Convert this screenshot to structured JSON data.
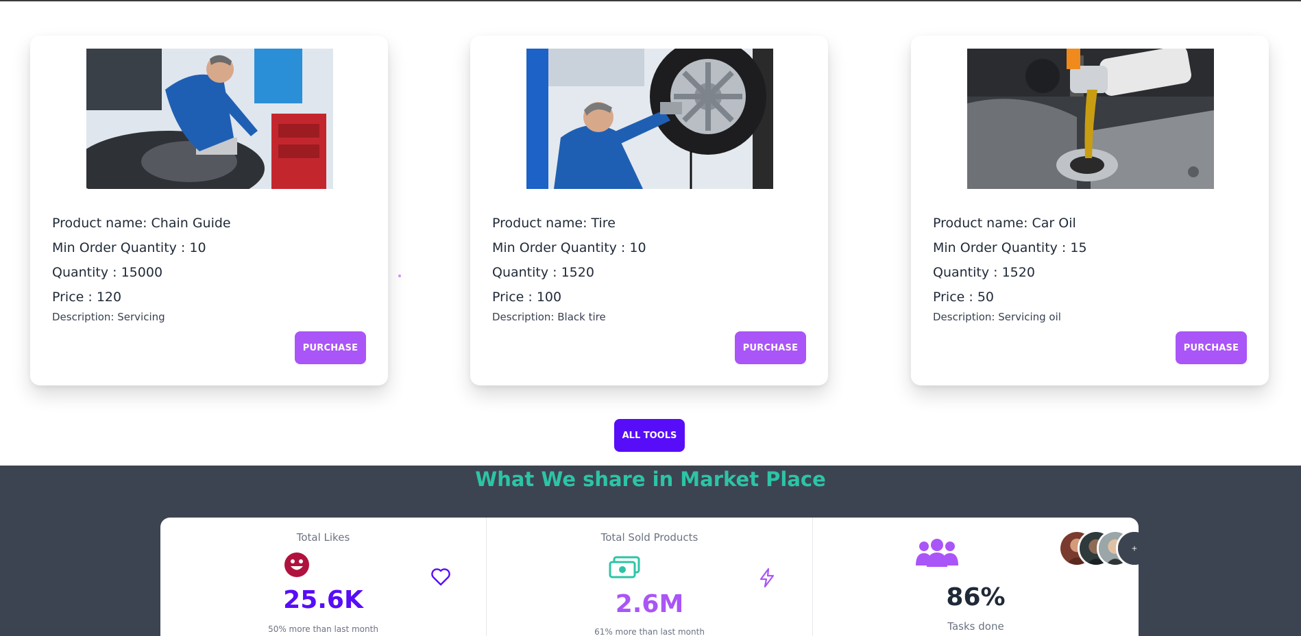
{
  "products": [
    {
      "name_line": "Product name: Chain Guide",
      "min_order_line": "Min Order Quantity : 10",
      "quantity_line": "Quantity : 15000",
      "price_line": "Price : 120",
      "description_line": "Description: Servicing",
      "button_label": "PURCHASE"
    },
    {
      "name_line": "Product name: Tire",
      "min_order_line": "Min Order Quantity : 10",
      "quantity_line": "Quantity : 1520",
      "price_line": "Price : 100",
      "description_line": "Description: Black tire",
      "button_label": "PURCHASE"
    },
    {
      "name_line": "Product name: Car Oil",
      "min_order_line": "Min Order Quantity : 15",
      "quantity_line": "Quantity : 1520",
      "price_line": "Price : 50",
      "description_line": "Description: Servicing oil",
      "button_label": "PURCHASE"
    }
  ],
  "all_tools_label": "ALL TOOLS",
  "section_title": "What We share in Market Place",
  "stats": [
    {
      "title": "Total Likes",
      "value": "25.6K",
      "desc": "50% more than last month",
      "value_color": "#570df8",
      "icon": "smile-icon",
      "side_icon": "heart-icon"
    },
    {
      "title": "Total Sold Products",
      "value": "2.6M",
      "desc": "61% more than last month",
      "value_color": "#a955f7",
      "icon": "cash-icon",
      "side_icon": "bolt-icon"
    },
    {
      "value": "86%",
      "desc": "Tasks done",
      "value_color": "#1f2937",
      "icon": "users-icon"
    }
  ],
  "colors": {
    "primary": "#570df8",
    "secondary": "#a955f7",
    "accent": "#2cc4a6",
    "dark_bg": "#3d4451"
  }
}
